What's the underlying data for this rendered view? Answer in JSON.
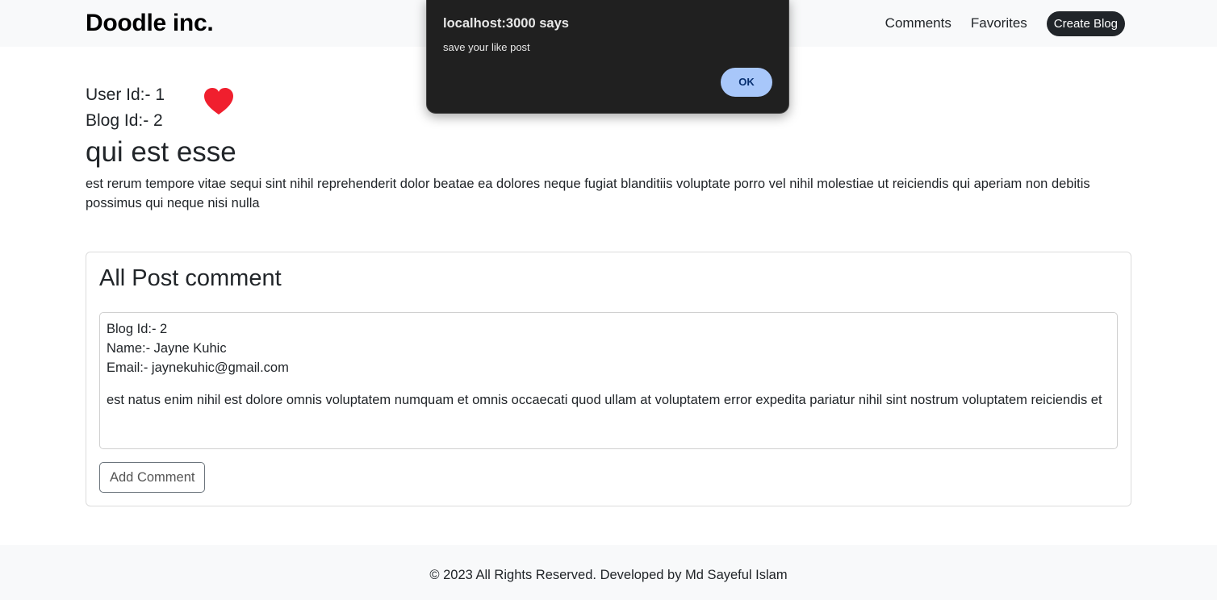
{
  "navbar": {
    "brand": "Doodle inc.",
    "links": [
      "Comments",
      "Favorites"
    ],
    "create_button": "Create Blog"
  },
  "post": {
    "user_id_label": "User Id:- 1",
    "blog_id_label": "Blog Id:- 2",
    "liked_icon": "heart-icon",
    "liked_color": "#f01f2e",
    "title": "qui est esse",
    "body": "est rerum tempore vitae sequi sint nihil reprehenderit dolor beatae ea dolores neque fugiat blanditiis voluptate porro vel nihil molestiae ut reiciendis qui aperiam non debitis possimus qui neque nisi nulla"
  },
  "comments": {
    "heading": "All Post comment",
    "items": [
      {
        "blog_id": "Blog Id:- 2",
        "name": "Name:- Jayne Kuhic",
        "email": "Email:- jaynekuhic@gmail.com",
        "body": "est natus enim nihil est dolore omnis voluptatem numquam et omnis occaecati quod ullam at voluptatem error expedita pariatur nihil sint nostrum voluptatem reiciendis et"
      }
    ],
    "add_button": "Add Comment"
  },
  "footer": {
    "text": "© 2023 All Rights Reserved. Developed by Md Sayeful Islam"
  },
  "alert": {
    "title": "localhost:3000 says",
    "message": "save your like post",
    "ok_label": "OK",
    "ok_color": "#a8c7fa"
  }
}
